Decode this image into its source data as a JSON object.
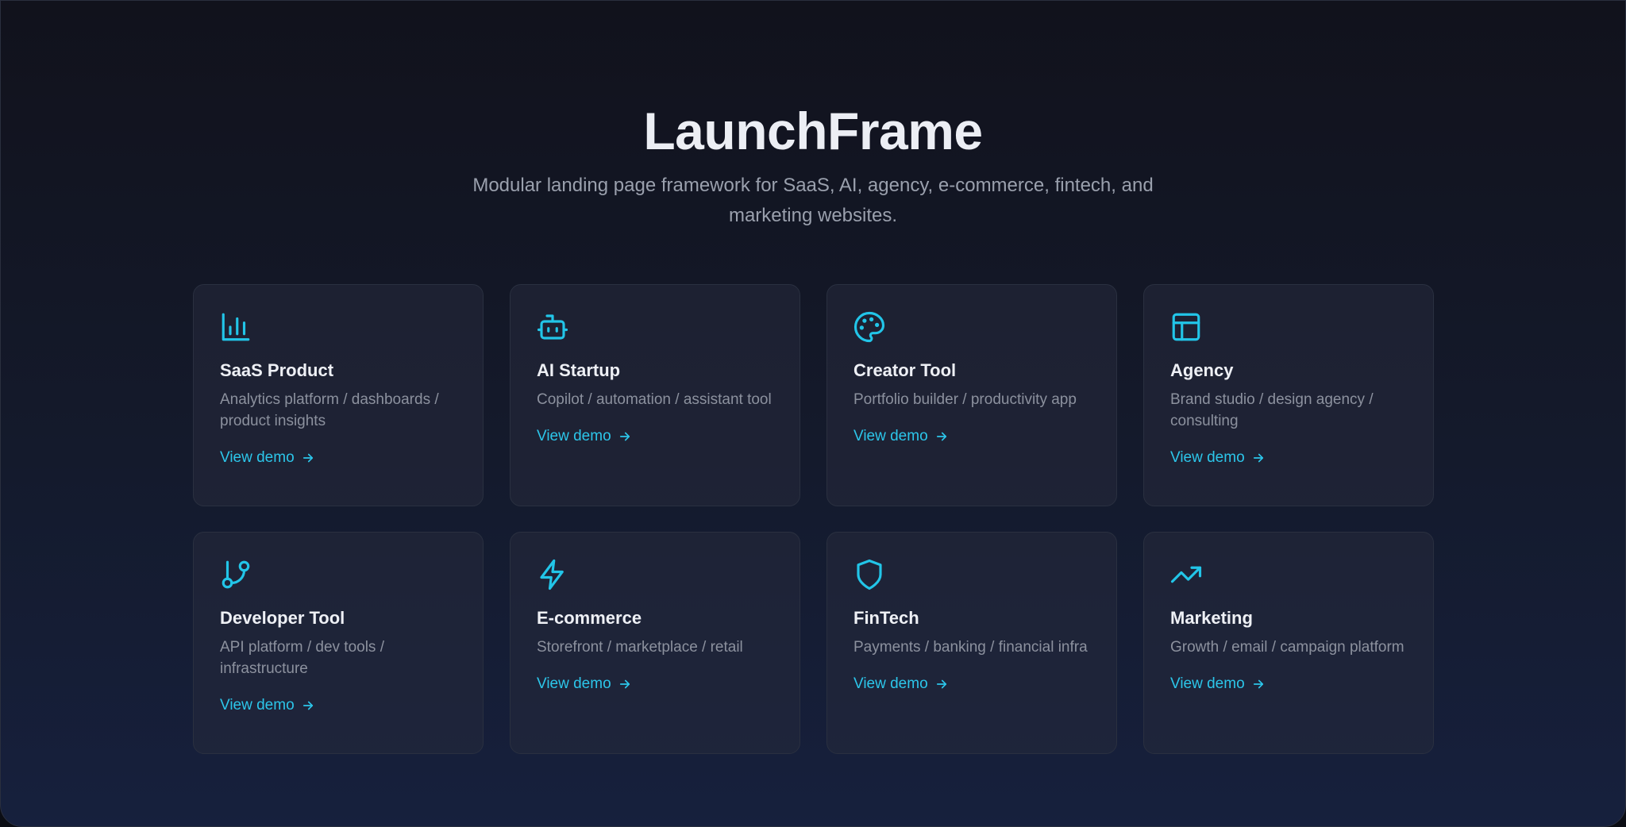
{
  "hero": {
    "title": "LaunchFrame",
    "subtitle": "Modular landing page framework for SaaS, AI, agency, e-commerce, fintech, and marketing websites."
  },
  "colors": {
    "accent": "#22c5e8",
    "background_top": "#11121c",
    "background_bottom": "#16203d",
    "card_border": "#2a3040"
  },
  "cards": [
    {
      "icon": "bar-chart-icon",
      "title": "SaaS Product",
      "description": "Analytics platform / dashboards / product insights",
      "link": "View demo"
    },
    {
      "icon": "bot-icon",
      "title": "AI Startup",
      "description": "Copilot / automation / assistant tool",
      "link": "View demo"
    },
    {
      "icon": "palette-icon",
      "title": "Creator Tool",
      "description": "Portfolio builder / productivity app",
      "link": "View demo"
    },
    {
      "icon": "layout-icon",
      "title": "Agency",
      "description": "Brand studio / design agency / consulting",
      "link": "View demo"
    },
    {
      "icon": "git-branch-icon",
      "title": "Developer Tool",
      "description": "API platform / dev tools / infrastructure",
      "link": "View demo"
    },
    {
      "icon": "lightning-icon",
      "title": "E-commerce",
      "description": "Storefront / marketplace / retail",
      "link": "View demo"
    },
    {
      "icon": "shield-icon",
      "title": "FinTech",
      "description": "Payments / banking / financial infra",
      "link": "View demo"
    },
    {
      "icon": "trending-up-icon",
      "title": "Marketing",
      "description": "Growth / email / campaign platform",
      "link": "View demo"
    }
  ]
}
